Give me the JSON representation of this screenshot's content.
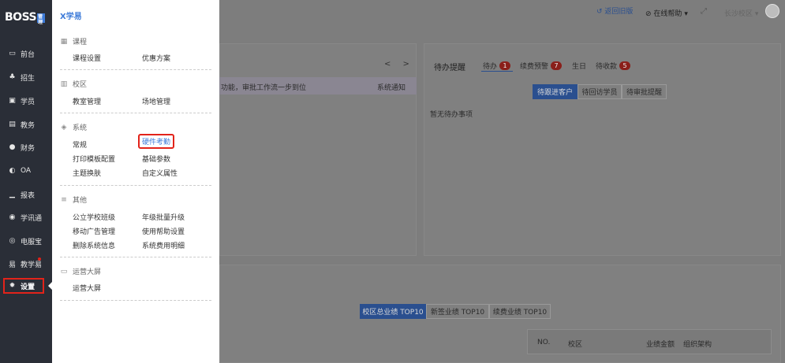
{
  "sidebar": {
    "logo_text": "BOSS",
    "logo_tag": "管理",
    "items": [
      {
        "label": "前台",
        "icon": "monitor-icon"
      },
      {
        "label": "招生",
        "icon": "people-icon"
      },
      {
        "label": "学员",
        "icon": "student-card-icon"
      },
      {
        "label": "教务",
        "icon": "book-icon"
      },
      {
        "label": "财务",
        "icon": "coin-icon"
      },
      {
        "label": "OA",
        "icon": "toggle-icon"
      },
      {
        "label": "报表",
        "icon": "bar-chart-icon"
      },
      {
        "label": "学讯通",
        "icon": "location-icon"
      },
      {
        "label": "电服宝",
        "icon": "phone-icon"
      },
      {
        "label": "教学易",
        "icon": "teach-icon"
      },
      {
        "label": "设置",
        "icon": "gear-icon"
      }
    ]
  },
  "menu": {
    "logo": "X学易",
    "sections": [
      {
        "title": "课程",
        "icon": "course-icon",
        "items": [
          "课程设置",
          "优惠方案"
        ]
      },
      {
        "title": "校区",
        "icon": "campus-icon",
        "items": [
          "教室管理",
          "场地管理"
        ]
      },
      {
        "title": "系统",
        "icon": "system-icon",
        "items": [
          "常规",
          "硬件考勤",
          "打印模板配置",
          "基础参数",
          "主题换肤",
          "自定义属性"
        ]
      },
      {
        "title": "其他",
        "icon": "other-icon",
        "items": [
          "公立学校班级",
          "年级批量升级",
          "移动广告管理",
          "使用帮助设置",
          "删除系统信息",
          "系统费用明细"
        ]
      },
      {
        "title": "运营大屏",
        "icon": "screen-icon",
        "items": [
          "运营大屏"
        ]
      }
    ]
  },
  "header": {
    "back_label": "返回旧版",
    "help_label": "在线帮助",
    "campus_label": "长沙校区"
  },
  "notice": {
    "pager": "< >",
    "text": "功能，审批工作流一步到位",
    "tag": "系统通知"
  },
  "todo": {
    "title": "待办提醒",
    "tabs": [
      {
        "label": "待办",
        "count": "1"
      },
      {
        "label": "续费预警",
        "count": "7"
      },
      {
        "label": "生日",
        "count": ""
      },
      {
        "label": "待收款",
        "count": "5"
      }
    ],
    "subtabs": [
      "待跟进客户",
      "待回访学员",
      "待审批提醒"
    ],
    "empty_text": "暂无待办事项"
  },
  "ranking": {
    "tabs": [
      "校区总业绩 TOP10",
      "新签业绩 TOP10",
      "续费业绩 TOP10"
    ],
    "columns": [
      "NO.",
      "校区",
      "业绩金额",
      "组织架构"
    ]
  },
  "colors": {
    "sidebar_bg": "#2a2e37",
    "accent_blue": "#3d7bd9",
    "highlight_red": "#e2231a"
  }
}
